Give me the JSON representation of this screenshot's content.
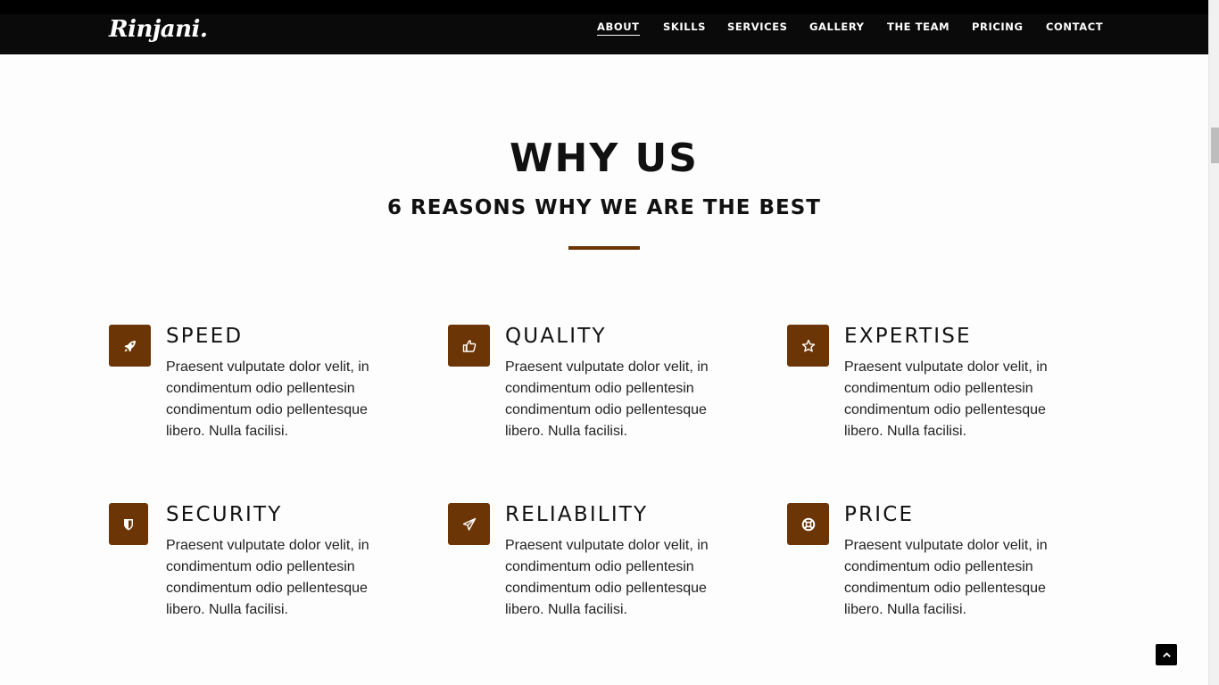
{
  "brand": {
    "logo_text": "Rinjani."
  },
  "nav": {
    "items": [
      {
        "label": "ABOUT",
        "active": true
      },
      {
        "label": "SKILLS",
        "active": false
      },
      {
        "label": "SERVICES",
        "active": false
      },
      {
        "label": "GALLERY",
        "active": false
      },
      {
        "label": "THE TEAM",
        "active": false
      },
      {
        "label": "PRICING",
        "active": false
      },
      {
        "label": "CONTACT",
        "active": false
      }
    ]
  },
  "section": {
    "title": "WHY US",
    "subtitle": "6 REASONS WHY WE ARE THE BEST",
    "accent_color": "#6b3506"
  },
  "features": [
    {
      "title": "SPEED",
      "icon": "rocket-icon",
      "text": "Praesent vulputate dolor velit, in condimentum odio pellentesin condimentum odio pellentesque libero. Nulla facilisi."
    },
    {
      "title": "QUALITY",
      "icon": "thumbs-up-icon",
      "text": "Praesent vulputate dolor velit, in condimentum odio pellentesin condimentum odio pellentesque libero. Nulla facilisi."
    },
    {
      "title": "EXPERTISE",
      "icon": "star-icon",
      "text": "Praesent vulputate dolor velit, in condimentum odio pellentesin condimentum odio pellentesque libero. Nulla facilisi."
    },
    {
      "title": "SECURITY",
      "icon": "shield-icon",
      "text": "Praesent vulputate dolor velit, in condimentum odio pellentesin condimentum odio pellentesque libero. Nulla facilisi."
    },
    {
      "title": "RELIABILITY",
      "icon": "paper-plane-icon",
      "text": "Praesent vulputate dolor velit, in condimentum odio pellentesin condimentum odio pellentesque libero. Nulla facilisi."
    },
    {
      "title": "PRICE",
      "icon": "life-ring-icon",
      "text": "Praesent vulputate dolor velit, in condimentum odio pellentesin condimentum odio pellentesque libero. Nulla facilisi."
    }
  ],
  "back_to_top": {
    "icon": "chevron-up-icon"
  }
}
